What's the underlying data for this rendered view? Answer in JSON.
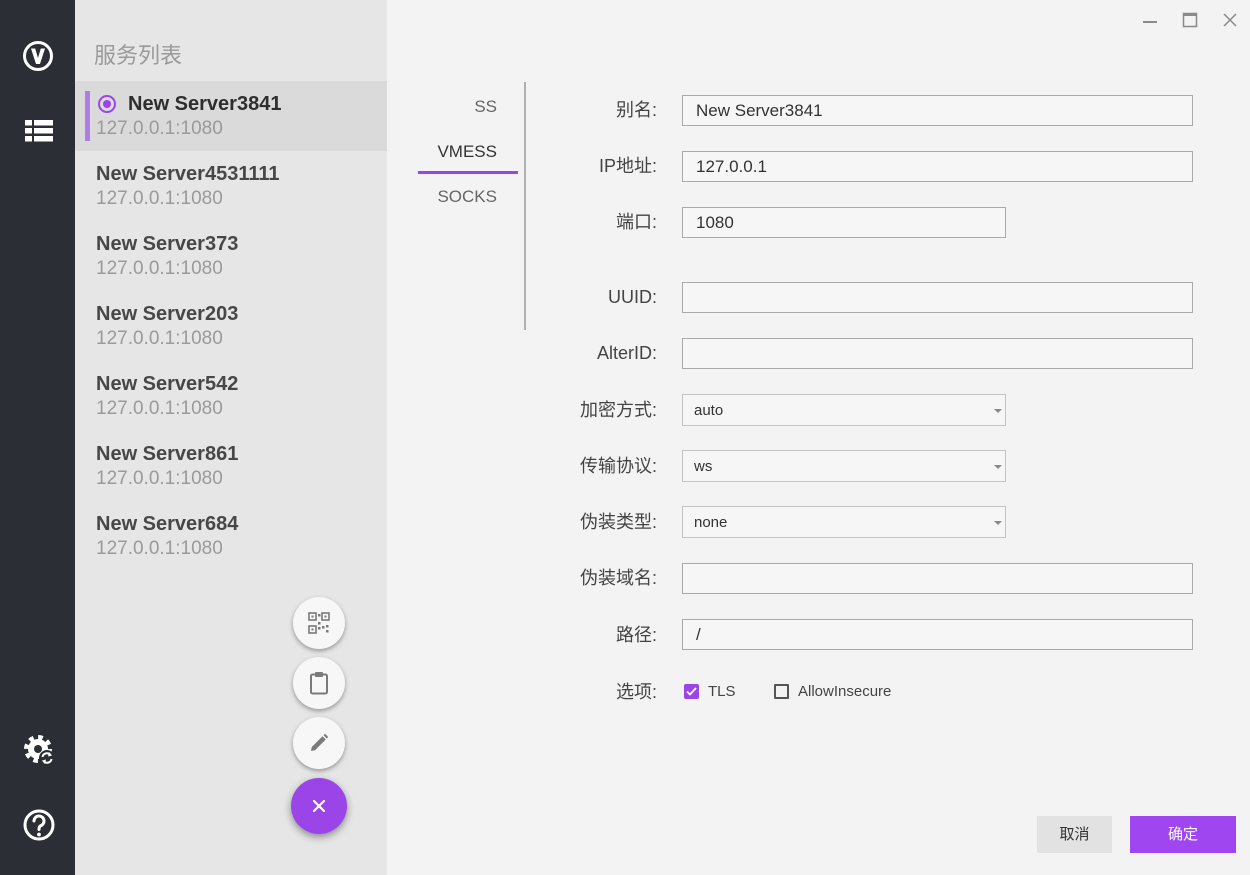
{
  "window": {
    "controls": [
      {
        "name": "minimize",
        "icon": "minimize-icon"
      },
      {
        "name": "maximize",
        "icon": "maximize-icon"
      },
      {
        "name": "close",
        "icon": "close-icon"
      }
    ]
  },
  "nav": {
    "top_icons": [
      "v2ray-logo-icon",
      "server-list-icon"
    ],
    "bottom_icons": [
      "settings-sync-icon",
      "help-icon"
    ]
  },
  "server_list": {
    "title": "服务列表",
    "items": [
      {
        "name": "New Server3841",
        "address": "127.0.0.1:1080",
        "selected": true
      },
      {
        "name": "New Server4531111",
        "address": "127.0.0.1:1080",
        "selected": false
      },
      {
        "name": "New Server373",
        "address": "127.0.0.1:1080",
        "selected": false
      },
      {
        "name": "New Server203",
        "address": "127.0.0.1:1080",
        "selected": false
      },
      {
        "name": "New Server542",
        "address": "127.0.0.1:1080",
        "selected": false
      },
      {
        "name": "New Server861",
        "address": "127.0.0.1:1080",
        "selected": false
      },
      {
        "name": "New Server684",
        "address": "127.0.0.1:1080",
        "selected": false
      }
    ]
  },
  "fab": {
    "actions": [
      "qr-scan-icon",
      "clipboard-icon",
      "edit-icon"
    ],
    "toggle_icon": "close-icon"
  },
  "tabs": [
    {
      "label": "SS",
      "active": false
    },
    {
      "label": "VMESS",
      "active": true
    },
    {
      "label": "SOCKS",
      "active": false
    }
  ],
  "form": {
    "alias": {
      "label": "别名:",
      "value": "New Server3841"
    },
    "ip": {
      "label": "IP地址:",
      "value": "127.0.0.1"
    },
    "port": {
      "label": "端口:",
      "value": "1080"
    },
    "uuid": {
      "label": "UUID:",
      "value": ""
    },
    "alter_id": {
      "label": "AlterID:",
      "value": ""
    },
    "encryption": {
      "label": "加密方式:",
      "value": "auto"
    },
    "transport": {
      "label": "传输协议:",
      "value": "ws"
    },
    "camouflage_type": {
      "label": "伪装类型:",
      "value": "none"
    },
    "camouflage_domain": {
      "label": "伪装域名:",
      "value": ""
    },
    "path": {
      "label": "路径:",
      "value": "/"
    },
    "options": {
      "label": "选项:",
      "tls": {
        "label": "TLS",
        "checked": true
      },
      "allow_insecure": {
        "label": "AllowInsecure",
        "checked": false
      }
    }
  },
  "buttons": {
    "cancel": "取消",
    "confirm": "确定"
  },
  "colors": {
    "accent": "#9b45e8",
    "nav_background": "#2b2e34",
    "list_background": "#e6e6e6",
    "selected_item_background": "#dadada",
    "main_background": "#f3f3f3"
  }
}
